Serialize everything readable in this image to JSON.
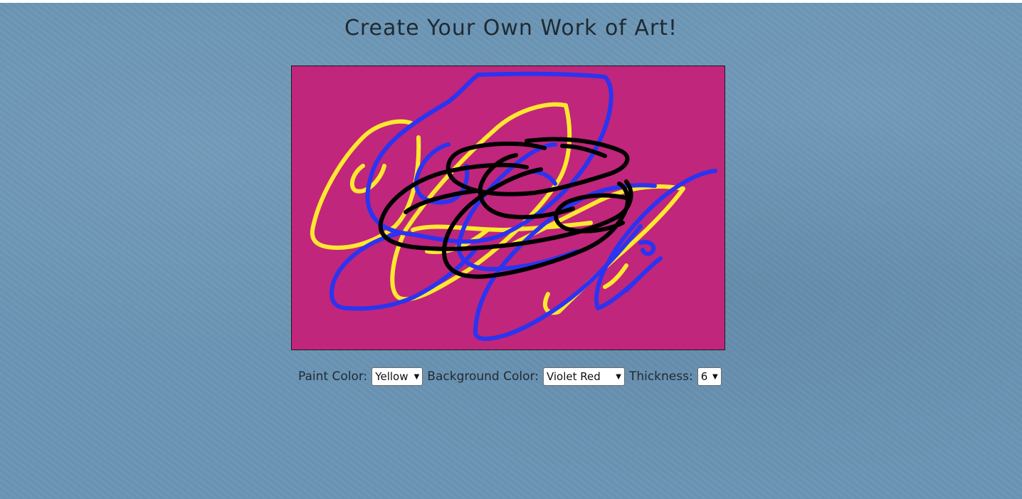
{
  "page": {
    "title": "Create Your Own Work of Art!"
  },
  "canvas": {
    "background_color": "#c0267b"
  },
  "controls": {
    "paint_color_label": "Paint Color:",
    "paint_color_value": "Yellow",
    "background_color_label": "Background Color:",
    "background_color_value": "Violet Red",
    "thickness_label": "Thickness:",
    "thickness_value": "6"
  },
  "colors": {
    "page_background": "#6b95b5",
    "stroke_yellow": "#ffe830",
    "stroke_blue": "#2b34f0",
    "stroke_black": "#000000"
  },
  "icons": {
    "dropdown_chevron": "chevron-down-icon"
  }
}
